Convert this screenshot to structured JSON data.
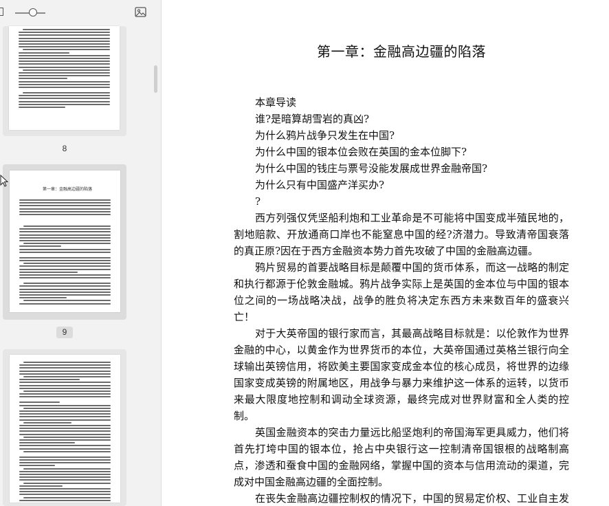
{
  "sidebar": {
    "pages": [
      {
        "label": "8",
        "active": false
      },
      {
        "label": "9",
        "active": true,
        "title": "第一章：金融高边疆的陷落"
      },
      {
        "label": "",
        "active": false
      }
    ]
  },
  "document": {
    "chapter_title": "第一章：金融高边疆的陷落",
    "intro_lines": [
      "本章导读",
      "谁?是暗算胡雪岩的真凶?",
      "为什么鸦片战争只发生在中国?",
      "为什么中国的银本位会败在英国的金本位脚下?",
      "为什么中国的钱庄与票号没能发展成世界金融帝国?",
      "为什么只有中国盛产洋买办?",
      "?"
    ],
    "paragraphs": [
      "西方列强仅凭坚船利炮和工业革命是不可能将中国变成半殖民地的，割地赔款、开放通商口岸也不能窒息中国的经?济潜力。导致清帝国衰落的真正原?因在于西方金融资本势力首先攻破了中国的金融高边疆。",
      "鸦片贸易的首要战略目标是颠覆中国的货币体系，而这一战略的制定和执行都源于伦敦金融城。鸦片战争实际上是英国的金本位与中国的银本位之间的一场战略决战，战争的胜负将决定东西方未来数百年的盛衰兴亡！",
      "对于大英帝国的银行家而言，其最高战略目标就是：以伦敦作为世界金融的中心，以黄金作为世界货币的本位，大英帝国通过英格兰银行向全球输出英镑信用，将欧美主要国家变成金本位的核心成员，将世界的边缘国家变成英镑的附属地区，用战争与暴力来维护这一体系的运转，以货币来最大限度地控制和调动全球资源，最终完成对世界财富和全人类的控制。",
      "英国金融资本的突击力量远比船坚炮利的帝国海军更具威力，他们将首先打垮中国的银本位，抢占中央银行这一控制清帝国银根的战略制高点，渗透和蚕食中国的金融网络，掌握中国的资本与信用流动的渠道，完成对中国金融高边疆的全面控制。",
      "在丧失金融高边疆控制权的情况下，中国的贸易定价权、工业自主发展的定位权、政府的财政税收权、军事与国防的开支权将逐步沦"
    ]
  },
  "colors": {
    "sidebar_bg": "#f2f2f2",
    "active_frame": "#dcdcdc",
    "text": "#111111"
  }
}
